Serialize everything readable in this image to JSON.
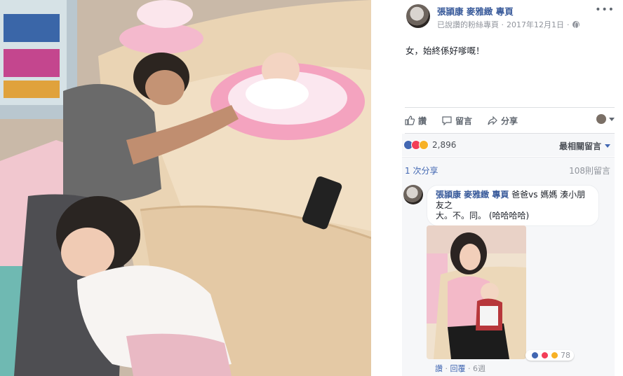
{
  "post": {
    "page_names": "張頴康 麥雅緻 專頁",
    "meta_prefix": "已說讚的粉絲專頁 · ",
    "date": "2017年12月1日",
    "meta_suffix": " · ",
    "text": "女，始終係好嗲嘅！"
  },
  "actions": {
    "like": "讚",
    "comment": "留言",
    "share": "分享"
  },
  "reactions": {
    "count": "2,896",
    "sort_label": "最相關留言"
  },
  "shares": {
    "share_count": "1 次分享",
    "comment_count": "108則留言"
  },
  "comment": {
    "author": "張頴康 麥雅緻 專頁",
    "text_line1": " 爸爸vs 媽媽 湊小朋友之",
    "text_line2": "大。不。同。 (哈哈哈哈)",
    "reaction_count": "78",
    "like_action": "讚",
    "reply_action": "回覆",
    "time": "6週",
    "separator": " · "
  },
  "icons": {
    "globe": "globe-icon",
    "more": "more-options-icon",
    "like": "thumbs-up-icon",
    "comment": "speech-bubble-icon",
    "share": "share-arrow-icon",
    "dropdown": "chevron-down-icon"
  },
  "colors": {
    "link": "#365899",
    "like": "#4267b2",
    "love": "#f33e58",
    "haha": "#f7b125",
    "muted": "#90949c"
  }
}
